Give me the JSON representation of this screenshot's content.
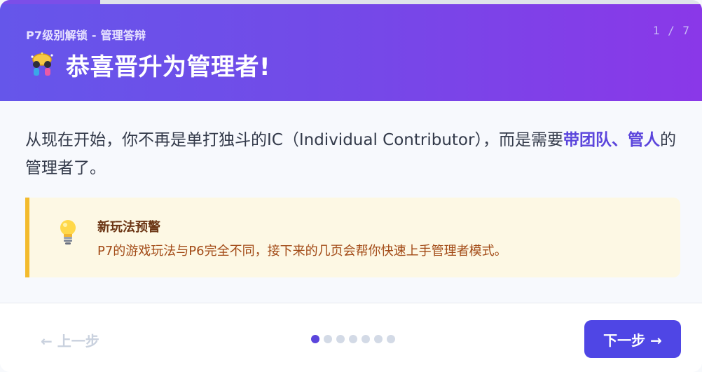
{
  "progress": {
    "fraction": 0.143
  },
  "header": {
    "subtitle": "P7级别解锁 - 管理答辩",
    "step_counter": "1 / 7",
    "title": "恭喜晋升为管理者!",
    "icon": "celebrate-icon"
  },
  "content": {
    "intro_before": "从现在开始，你不再是单打独斗的IC（Individual Contributor），而是需要",
    "intro_highlight": "带团队、管人",
    "intro_after": "的管理者了。",
    "tip": {
      "icon": "lightbulb-icon",
      "title": "新玩法预警",
      "text": "P7的游戏玩法与P6完全不同，接下来的几页会帮你快速上手管理者模式。"
    }
  },
  "footer": {
    "prev_label": "← 上一步",
    "next_label": "下一步 →",
    "total_pages": 7,
    "current_page": 1
  },
  "colors": {
    "accent": "#4f46e5",
    "highlight": "#5b45dc",
    "tip_border": "#f3bb2d",
    "tip_bg": "#fdf8e4"
  }
}
